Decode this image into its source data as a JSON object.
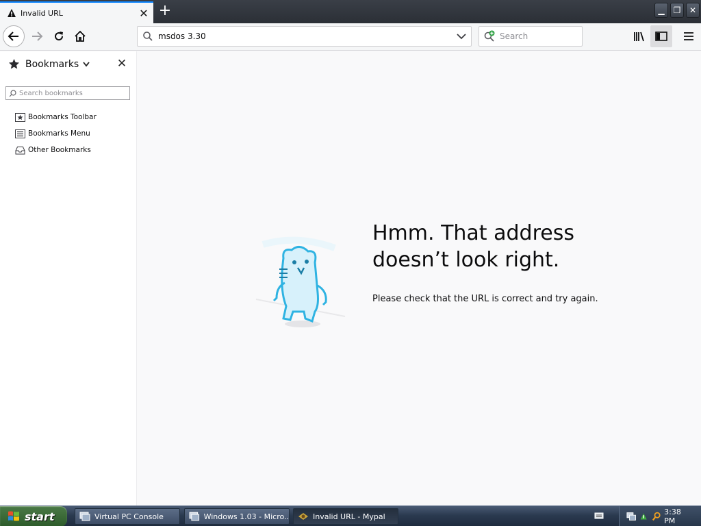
{
  "tab": {
    "title": "Invalid URL",
    "close_label": "✕"
  },
  "newtab_label": "+",
  "window": {
    "minimize": "▁",
    "restore": "❐",
    "close": "✕"
  },
  "urlbar": {
    "value": "msdos 3.30"
  },
  "search": {
    "placeholder": "Search"
  },
  "sidebar": {
    "title": "Bookmarks",
    "close_label": "✕",
    "search_placeholder": "Search bookmarks",
    "items": [
      {
        "label": "Bookmarks Toolbar",
        "icon": "bookmarks-toolbar-icon"
      },
      {
        "label": "Bookmarks Menu",
        "icon": "bookmarks-menu-icon"
      },
      {
        "label": "Other Bookmarks",
        "icon": "other-bookmarks-icon"
      }
    ]
  },
  "error": {
    "title": "Hmm. That address doesn’t look right.",
    "description": "Please check that the URL is correct and try again."
  },
  "taskbar": {
    "start_label": "start",
    "tasks": [
      {
        "label": "Virtual PC Console"
      },
      {
        "label": "Windows 1.03 - Micro..."
      },
      {
        "label": "Invalid URL - Mypal"
      }
    ],
    "clock": "3:38 PM"
  },
  "colors": {
    "accent": "#0a84ff",
    "taskbar": "#2b3a50",
    "start": "#3f7a3a"
  }
}
